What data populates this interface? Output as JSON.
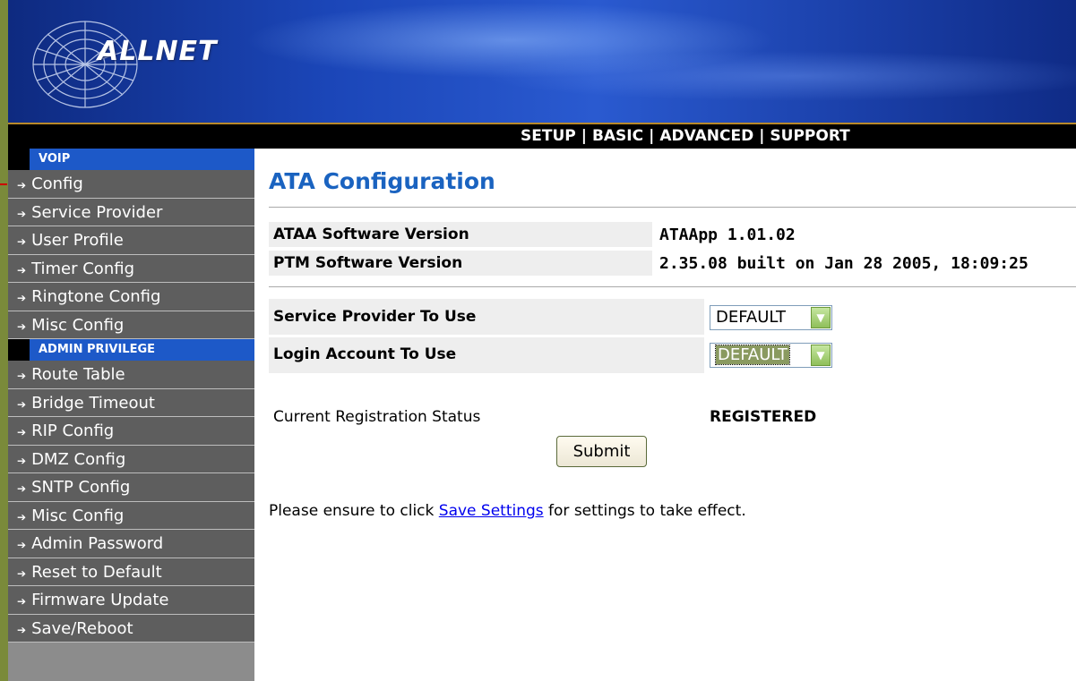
{
  "brand": {
    "logo_text": "ALLNET"
  },
  "topnav": {
    "items": [
      "SETUP",
      "BASIC",
      "ADVANCED",
      "SUPPORT"
    ],
    "separator": "|"
  },
  "sidebar": {
    "voip_header": "VOIP",
    "voip_items": [
      "Config",
      "Service Provider",
      "User Profile",
      "Timer Config",
      "Ringtone Config",
      "Misc Config"
    ],
    "admin_header": "ADMIN PRIVILEGE",
    "admin_items": [
      "Route Table",
      "Bridge Timeout",
      "RIP Config",
      "DMZ Config",
      "SNTP Config",
      "Misc Config",
      "Admin Password",
      "Reset to Default",
      "Firmware Update",
      "Save/Reboot"
    ]
  },
  "main": {
    "title": "ATA Configuration",
    "ataa_label": "ATAA Software Version",
    "ataa_value": "ATAApp 1.01.02",
    "ptm_label": "PTM Software Version",
    "ptm_value": "2.35.08 built on Jan 28 2005, 18:09:25",
    "service_provider_label": "Service Provider To Use",
    "service_provider_value": "DEFAULT",
    "login_account_label": "Login Account To Use",
    "login_account_value": "DEFAULT",
    "reg_status_label": "Current Registration Status",
    "reg_status_value": "REGISTERED",
    "submit_label": "Submit",
    "note_prefix": "Please ensure to click ",
    "note_link": "Save Settings",
    "note_suffix": " for settings to take effect."
  },
  "colors": {
    "accent_title": "#1a63c0",
    "sidebar_header": "#1d59c8",
    "sidebar_item": "#5e5e5e",
    "dropdown_button": "#8fbf5a"
  }
}
